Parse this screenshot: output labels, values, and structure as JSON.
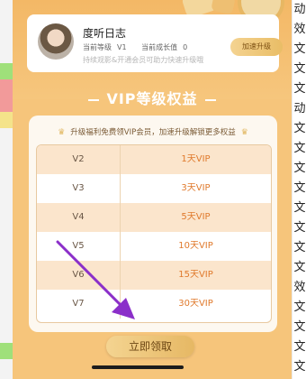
{
  "user": {
    "name": "度听日志",
    "level_label": "当前等级",
    "level_value": "V1",
    "growth_label": "当前成长值",
    "growth_value": "0",
    "tip": "持续观影&开通会员可助力快速升级哦",
    "upgrade_button": "加速升级"
  },
  "section": {
    "title": "VIP等级权益",
    "subtitle": "升级福利免费领VIP会员，加速升级解锁更多权益"
  },
  "rights": [
    {
      "level": "V2",
      "gift": "1天VIP"
    },
    {
      "level": "V3",
      "gift": "3天VIP"
    },
    {
      "level": "V4",
      "gift": "5天VIP"
    },
    {
      "level": "V5",
      "gift": "10天VIP"
    },
    {
      "level": "V6",
      "gift": "15天VIP"
    },
    {
      "level": "V7",
      "gift": "30天VIP"
    }
  ],
  "claim_button": "立即领取",
  "background_right_column": [
    "动",
    "效",
    "文",
    "文",
    "文",
    "动",
    "文",
    "文",
    "文",
    "文",
    "文",
    "文",
    "文",
    "文",
    "效",
    "文",
    "文",
    "文",
    "文"
  ],
  "colors": {
    "modal_bg": "#f6c57b",
    "card_bg": "#fdf8f0",
    "gift_text": "#e07a2d",
    "arrow": "#8b2fc9"
  }
}
